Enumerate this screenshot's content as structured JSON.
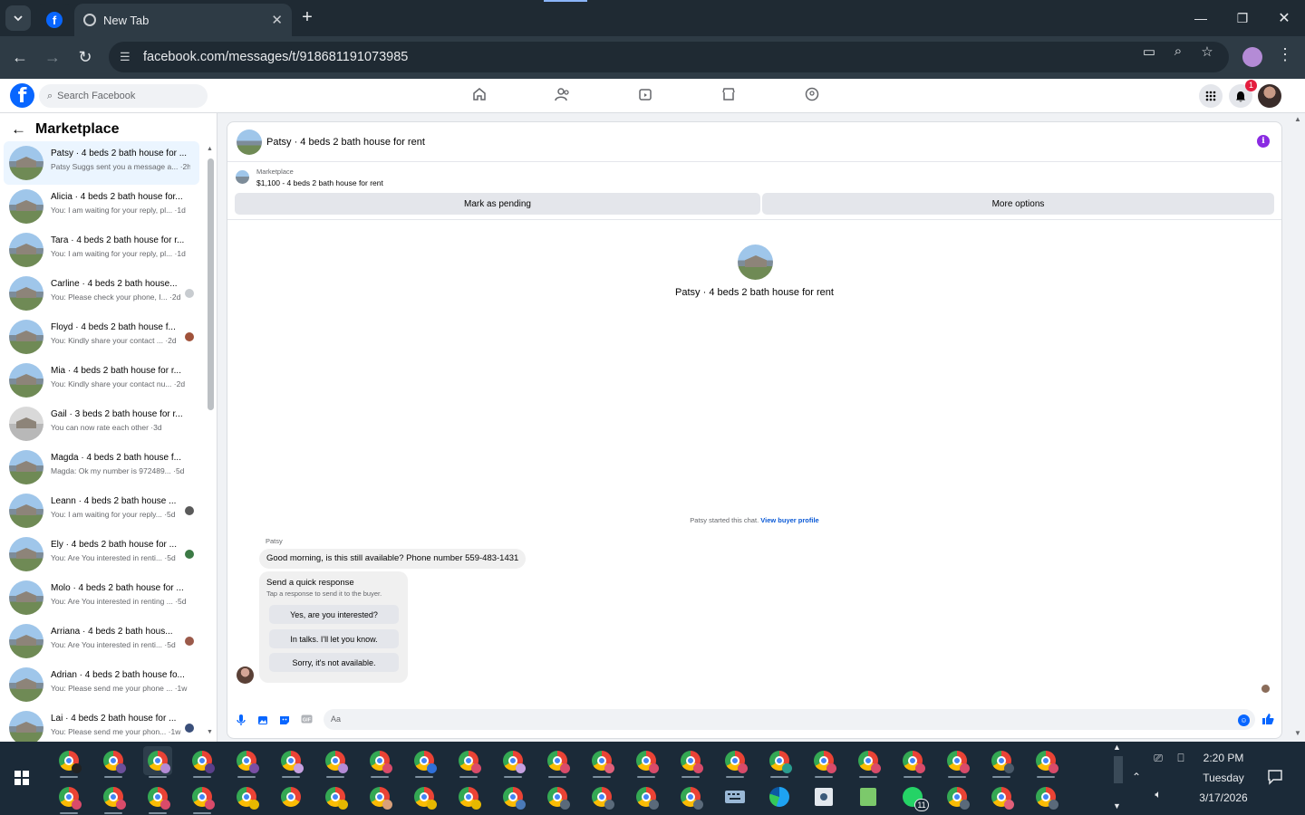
{
  "browser": {
    "tab_title": "New Tab",
    "url": "facebook.com/messages/t/918681191073985"
  },
  "fb": {
    "search_placeholder": "Search Facebook",
    "notification_count": "1"
  },
  "sidebar": {
    "title": "Marketplace",
    "conversations": [
      {
        "name": "Patsy · 4 beds 2 bath house for ...",
        "snippet": "Patsy Suggs sent you a message a... ·2h"
      },
      {
        "name": "Alicia · 4 beds 2 bath house for...",
        "snippet": "You: I am waiting for your reply, pl... ·1d"
      },
      {
        "name": "Tara · 4 beds 2 bath house for r...",
        "snippet": "You: I am waiting for your reply, pl... ·1d"
      },
      {
        "name": "Carline · 4 beds 2 bath house...",
        "snippet": "You: Please check your phone, I... ·2d"
      },
      {
        "name": "Floyd · 4 beds 2 bath house f...",
        "snippet": "You: Kindly share your contact ... ·2d"
      },
      {
        "name": "Mia · 4 beds 2 bath house for r...",
        "snippet": "You: Kindly share your contact nu... ·2d"
      },
      {
        "name": "Gail · 3 beds 2 bath house for r...",
        "snippet": "You can now rate each other ·3d"
      },
      {
        "name": "Magda · 4 beds 2 bath house f...",
        "snippet": "Magda: Ok my number is 972489... ·5d"
      },
      {
        "name": "Leann · 4 beds 2 bath house ...",
        "snippet": "You: I am waiting for your reply... ·5d"
      },
      {
        "name": "Ely · 4 beds 2 bath house for ...",
        "snippet": "You: Are You interested in renti... ·5d"
      },
      {
        "name": "Molo · 4 beds 2 bath house for ...",
        "snippet": "You: Are You interested in renting ... ·5d"
      },
      {
        "name": "Arriana · 4 beds 2 bath hous...",
        "snippet": "You: Are You interested in renti... ·5d"
      },
      {
        "name": "Adrian · 4 beds 2 bath house fo...",
        "snippet": "You: Please send me your phone ... ·1w"
      },
      {
        "name": "Lai · 4 beds 2 bath house for ...",
        "snippet": "You: Please send me your phon... ·1w"
      }
    ]
  },
  "chat": {
    "header_title": "Patsy · 4 beds 2 bath house for rent",
    "listing_label": "Marketplace",
    "listing_price": "$1,100 - 4 beds 2 bath house for rent",
    "mark_pending": "Mark as pending",
    "more_options": "More options",
    "hero_name": "Patsy · 4 beds 2 bath house for rent",
    "started_text": "Patsy started this chat.",
    "view_profile": "View buyer profile",
    "sender": "Patsy",
    "message": "Good morning, is this still available? Phone number  559-483-1431",
    "quick_title": "Send a quick response",
    "quick_subtitle": "Tap a response to send it to the buyer.",
    "quick_replies": [
      "Yes, are you interested?",
      "In talks. I'll let you know.",
      "Sorry, it's not available."
    ],
    "composer_placeholder": "Aa"
  },
  "taskbar": {
    "time": "2:20 PM",
    "day": "Tuesday",
    "date": "3/17/2026",
    "whatsapp_badge": "11"
  }
}
